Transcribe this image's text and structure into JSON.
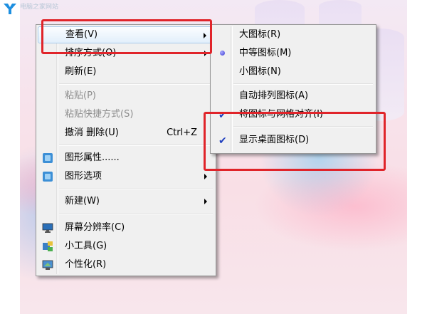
{
  "watermark": "电脑之家网站",
  "menu": {
    "items": [
      {
        "label": "查看(V)",
        "has_submenu": true,
        "highlighted": true
      },
      {
        "label": "排序方式(O)",
        "has_submenu": true
      },
      {
        "label": "刷新(E)"
      },
      {
        "label": "粘贴(P)",
        "disabled": true
      },
      {
        "label": "粘贴快捷方式(S)",
        "disabled": true
      },
      {
        "label": "撤消 删除(U)",
        "shortcut": "Ctrl+Z"
      },
      {
        "label": "图形属性......",
        "icon": "graphics-properties-icon"
      },
      {
        "label": "图形选项",
        "icon": "graphics-options-icon",
        "has_submenu": true
      },
      {
        "label": "新建(W)",
        "has_submenu": true
      },
      {
        "label": "屏幕分辨率(C)",
        "icon": "monitor-icon"
      },
      {
        "label": "小工具(G)",
        "icon": "gadgets-icon"
      },
      {
        "label": "个性化(R)",
        "icon": "personalize-icon"
      }
    ]
  },
  "submenu": {
    "items": [
      {
        "label": "大图标(R)"
      },
      {
        "label": "中等图标(M)",
        "selected": true
      },
      {
        "label": "小图标(N)"
      },
      {
        "label": "自动排列图标(A)"
      },
      {
        "label": "将图标与网格对齐(I)",
        "checked": true
      },
      {
        "label": "显示桌面图标(D)",
        "checked": true
      }
    ]
  },
  "colors": {
    "annotation": "#e0242a",
    "menu_bg": "#f0f0f0",
    "highlight_border": "#aacbea",
    "check": "#1f3fbf"
  }
}
